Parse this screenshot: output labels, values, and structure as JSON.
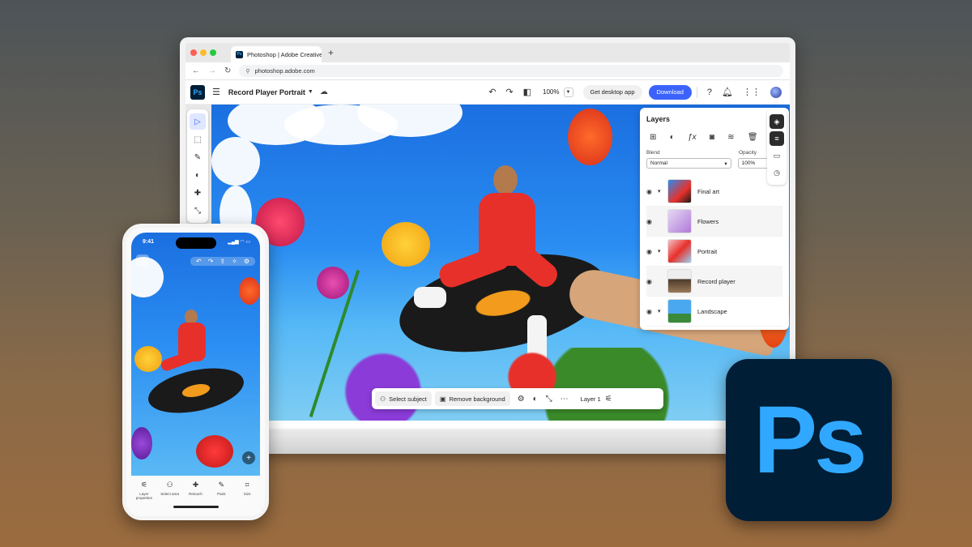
{
  "browser": {
    "tab_title": "Photoshop | Adobe Creative C",
    "tab_close": "×",
    "new_tab": "+",
    "url": "photoshop.adobe.com"
  },
  "app": {
    "logo_text": "Ps",
    "document_title": "Record Player Portrait",
    "zoom": "100%",
    "desktop_button": "Get desktop app",
    "download_button": "Download"
  },
  "layers_panel": {
    "title": "Layers",
    "blend_label": "Blend",
    "blend_value": "Normal",
    "opacity_label": "Opacity",
    "opacity_value": "100%",
    "layers": [
      {
        "name": "Final art"
      },
      {
        "name": "Flowers"
      },
      {
        "name": "Portrait"
      },
      {
        "name": "Record player"
      },
      {
        "name": "Landscape"
      }
    ]
  },
  "taskbar": {
    "select_subject": "Select subject",
    "remove_background": "Remove background",
    "layer_label": "Layer 1"
  },
  "phone": {
    "time": "9:41",
    "bottom_items": [
      {
        "label": "Layer properties",
        "icon": "sliders-icon"
      },
      {
        "label": "Select area",
        "icon": "select-icon"
      },
      {
        "label": "Retouch",
        "icon": "bandage-icon"
      },
      {
        "label": "Paint",
        "icon": "brush-icon"
      },
      {
        "label": "Size",
        "icon": "crop-icon"
      }
    ]
  },
  "big_logo_text": "Ps",
  "colors": {
    "ps_dark": "#001e36",
    "ps_blue": "#31a8ff",
    "download_blue": "#3b63fb"
  }
}
